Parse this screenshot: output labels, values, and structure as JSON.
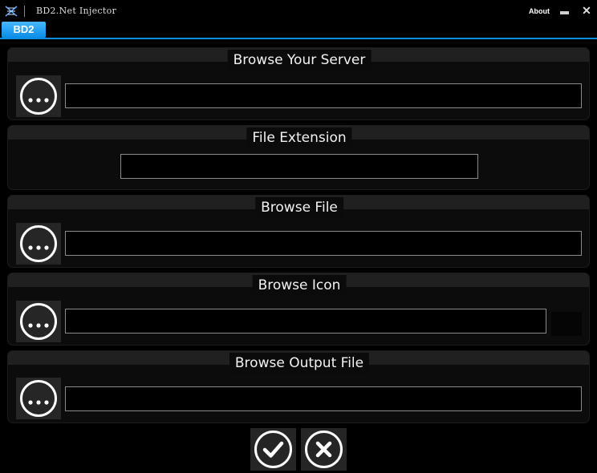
{
  "window": {
    "title": "BD2.Net Injector",
    "about_label": "About",
    "app_icon": "dna-icon",
    "min_icon": "minimize-icon",
    "close_icon": "close-icon",
    "close_glyph": "✕"
  },
  "tabs": [
    {
      "label": "BD2",
      "active": true
    }
  ],
  "colors": {
    "accent": "#0a8ce6",
    "background": "#000000",
    "panel": "#0c0c0c",
    "panel_header": "#202020",
    "button": "#262626",
    "input_border": "#8a8a8a"
  },
  "sections": {
    "server": {
      "title": "Browse Your Server",
      "value": "",
      "browse_icon": "ellipsis-icon"
    },
    "extension": {
      "title": "File Extension",
      "value": ""
    },
    "file": {
      "title": "Browse File",
      "value": "",
      "browse_icon": "ellipsis-icon"
    },
    "icon": {
      "title": "Browse Icon",
      "value": "",
      "browse_icon": "ellipsis-icon"
    },
    "output": {
      "title": "Browse Output File",
      "value": "",
      "browse_icon": "ellipsis-icon"
    }
  },
  "actions": {
    "confirm_icon": "checkmark-icon",
    "cancel_icon": "x-icon"
  }
}
